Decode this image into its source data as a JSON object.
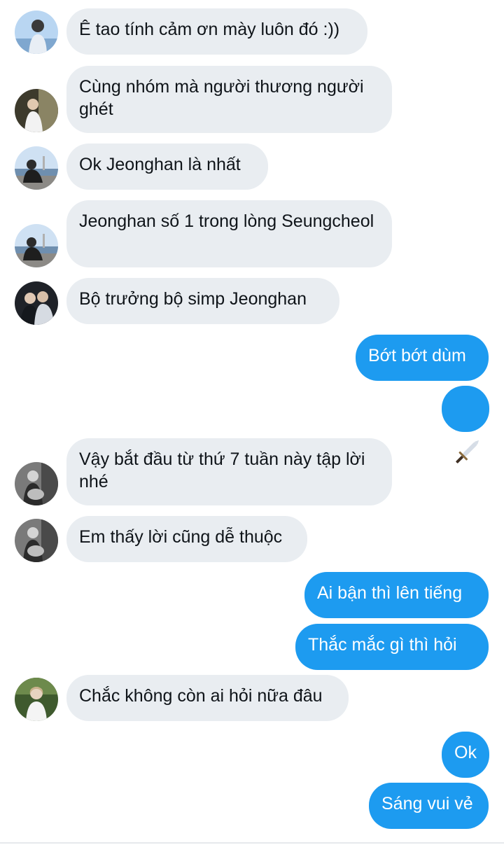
{
  "conversation": {
    "messages": [
      {
        "id": 1,
        "direction": "in",
        "text": "Ê tao tính cảm ơn mày luôn đó :))",
        "avatar": "avatar-sky"
      },
      {
        "id": 2,
        "direction": "in",
        "text": "Cùng nhóm mà người thương người ghét",
        "avatar": "avatar-dark"
      },
      {
        "id": 3,
        "direction": "in",
        "text": "Ok Jeonghan là nhất",
        "avatar": "avatar-seaside"
      },
      {
        "id": 4,
        "direction": "in",
        "text": "Jeonghan số 1 trong lòng Seungcheol",
        "avatar": "avatar-seaside"
      },
      {
        "id": 5,
        "direction": "in",
        "text": "Bộ trưởng bộ simp Jeonghan",
        "avatar": "avatar-duo"
      },
      {
        "id": 6,
        "direction": "out",
        "text": "Bớt bớt dùm"
      },
      {
        "id": 7,
        "direction": "out",
        "text": "🗡️",
        "is_emoji": true
      },
      {
        "id": 8,
        "direction": "in",
        "text": "Vậy bắt đầu từ thứ 7 tuần này tập lời nhé",
        "avatar": "avatar-guitar"
      },
      {
        "id": 9,
        "direction": "in",
        "text": "Em thấy lời cũng dễ thuộc",
        "avatar": "avatar-guitar"
      },
      {
        "id": 10,
        "direction": "out",
        "text": "Ai bận thì lên tiếng"
      },
      {
        "id": 11,
        "direction": "out",
        "text": "Thắc mắc gì thì hỏi"
      },
      {
        "id": 12,
        "direction": "in",
        "text": "Chắc không còn ai hỏi nữa đâu",
        "avatar": "avatar-green"
      },
      {
        "id": 13,
        "direction": "out",
        "text": "Ok"
      },
      {
        "id": 14,
        "direction": "out",
        "text": "Sáng vui vẻ"
      }
    ]
  },
  "colors": {
    "incoming_bubble": "#e9edf1",
    "outgoing_bubble": "#1d9bf0",
    "incoming_text": "#0f1419",
    "outgoing_text": "#ffffff"
  }
}
